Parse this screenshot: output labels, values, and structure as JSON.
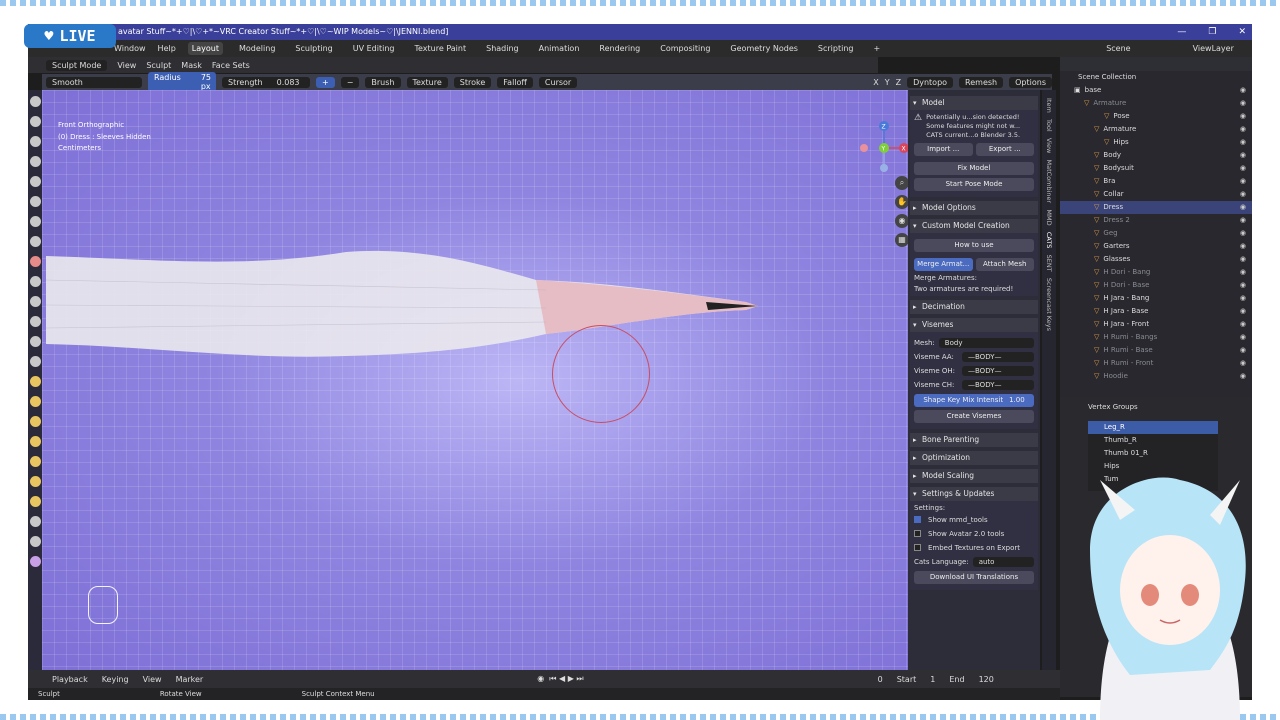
{
  "stream": {
    "live_label": "LIVE"
  },
  "title": "avatar Stuff~*+♡|\\♡+*~VRC Creator Stuff~*+♡|\\♡~WIP Models~♡|\\JENNI.blend]",
  "menu": {
    "window": "Window",
    "help": "Help"
  },
  "workspaces": [
    "Layout",
    "Modeling",
    "Sculpting",
    "UV Editing",
    "Texture Paint",
    "Shading",
    "Animation",
    "Rendering",
    "Compositing",
    "Geometry Nodes",
    "Scripting",
    "+"
  ],
  "scene": {
    "label": "Scene",
    "view_layer": "ViewLayer"
  },
  "header": {
    "mode": "Sculpt Mode",
    "view": "View",
    "sculpt": "Sculpt",
    "mask": "Mask",
    "face_sets": "Face Sets"
  },
  "tool": {
    "brush_name": "Smooth",
    "radius_label": "Radius",
    "radius_value": "75 px",
    "strength_label": "Strength",
    "strength_value": "0.083",
    "menus": [
      "Brush",
      "Texture",
      "Stroke",
      "Falloff",
      "Cursor"
    ],
    "right": [
      "X",
      "Y",
      "Z",
      "Dyntopo",
      "Remesh",
      "Options"
    ]
  },
  "viewport": {
    "projection": "Front Orthographic",
    "object": "(0) Dress : Sleeves Hidden",
    "units": "Centimeters"
  },
  "npanel": {
    "tabs": [
      "Item",
      "Tool",
      "View",
      "MatCombiner",
      "MMD",
      "CATS",
      "SENT",
      "Screencast Keys"
    ],
    "model": {
      "title": "Model",
      "warning": [
        "Potentially u...sion detected!",
        "Some features might not w...",
        "CATS current...o Blender 3.5."
      ],
      "import": "Import ...",
      "export": "Export ...",
      "fix_model": "Fix Model",
      "start_pose": "Start Pose Mode"
    },
    "model_options": "Model Options",
    "custom_model": {
      "title": "Custom Model Creation",
      "how_to_use": "How to use",
      "merge_armatures": "Merge Armat...",
      "attach_mesh": "Attach Mesh",
      "merge_label": "Merge Armatures:",
      "merge_info": "Two armatures are required!"
    },
    "decimation": "Decimation",
    "visemes": {
      "title": "Visemes",
      "mesh_label": "Mesh:",
      "mesh_value": "Body",
      "rows": [
        {
          "label": "Viseme AA:",
          "value": "—BODY—"
        },
        {
          "label": "Viseme OH:",
          "value": "—BODY—"
        },
        {
          "label": "Viseme CH:",
          "value": "—BODY—"
        }
      ],
      "mix_label": "Shape Key Mix Intensit",
      "mix_value": "1.00",
      "create": "Create Visemes"
    },
    "bone_parenting": "Bone Parenting",
    "optimization": "Optimization",
    "model_scaling": "Model Scaling",
    "settings": {
      "title": "Settings & Updates",
      "settings_label": "Settings:",
      "options": [
        {
          "label": "Show mmd_tools",
          "checked": true
        },
        {
          "label": "Show Avatar 2.0 tools",
          "checked": false
        },
        {
          "label": "Embed Textures on Export",
          "checked": false
        }
      ],
      "language_label": "Cats Language:",
      "language_value": "auto",
      "download": "Download UI Translations"
    }
  },
  "outliner": {
    "title": "Scene Collection",
    "rows": [
      {
        "name": "base",
        "depth": 0,
        "dim": false,
        "sel": false
      },
      {
        "name": "Armature",
        "depth": 1,
        "dim": true,
        "sel": false
      },
      {
        "name": "Pose",
        "depth": 3,
        "dim": false,
        "sel": false
      },
      {
        "name": "Armature",
        "depth": 2,
        "dim": false,
        "sel": false
      },
      {
        "name": "Hips",
        "depth": 3,
        "dim": false,
        "sel": false
      },
      {
        "name": "Body",
        "depth": 2,
        "dim": false,
        "sel": false
      },
      {
        "name": "Bodysuit",
        "depth": 2,
        "dim": false,
        "sel": false
      },
      {
        "name": "Bra",
        "depth": 2,
        "dim": false,
        "sel": false
      },
      {
        "name": "Collar",
        "depth": 2,
        "dim": false,
        "sel": false
      },
      {
        "name": "Dress",
        "depth": 2,
        "dim": false,
        "sel": true
      },
      {
        "name": "Dress 2",
        "depth": 2,
        "dim": true,
        "sel": false
      },
      {
        "name": "Geg",
        "depth": 2,
        "dim": true,
        "sel": false
      },
      {
        "name": "Garters",
        "depth": 2,
        "dim": false,
        "sel": false
      },
      {
        "name": "Glasses",
        "depth": 2,
        "dim": false,
        "sel": false
      },
      {
        "name": "H Dori - Bang",
        "depth": 2,
        "dim": true,
        "sel": false
      },
      {
        "name": "H Dori - Base",
        "depth": 2,
        "dim": true,
        "sel": false
      },
      {
        "name": "H Jara - Bang",
        "depth": 2,
        "dim": false,
        "sel": false
      },
      {
        "name": "H Jara - Base",
        "depth": 2,
        "dim": false,
        "sel": false
      },
      {
        "name": "H Jara - Front",
        "depth": 2,
        "dim": false,
        "sel": false
      },
      {
        "name": "H Rumi - Bangs",
        "depth": 2,
        "dim": true,
        "sel": false
      },
      {
        "name": "H Rumi - Base",
        "depth": 2,
        "dim": true,
        "sel": false
      },
      {
        "name": "H Rumi - Front",
        "depth": 2,
        "dim": true,
        "sel": false
      },
      {
        "name": "Hoodie",
        "depth": 2,
        "dim": true,
        "sel": false
      }
    ]
  },
  "properties": {
    "vertex_groups_title": "Vertex Groups",
    "groups": [
      "Leg_R",
      "Thumb_R",
      "Thumb 01_R",
      "Hips",
      "Tum"
    ]
  },
  "timeline": {
    "playback": "Playback",
    "keying": "Keying",
    "view": "View",
    "marker": "Marker",
    "current": "0",
    "start_label": "Start",
    "start": "1",
    "end_label": "End",
    "end": "120"
  },
  "status": {
    "left": "Sculpt",
    "middle": "Rotate View",
    "right": "Sculpt Context Menu"
  },
  "colors": {
    "viewport_bg": "#8f85e0",
    "accent": "#4b6bc0",
    "title_bar": "#3a3f99"
  }
}
